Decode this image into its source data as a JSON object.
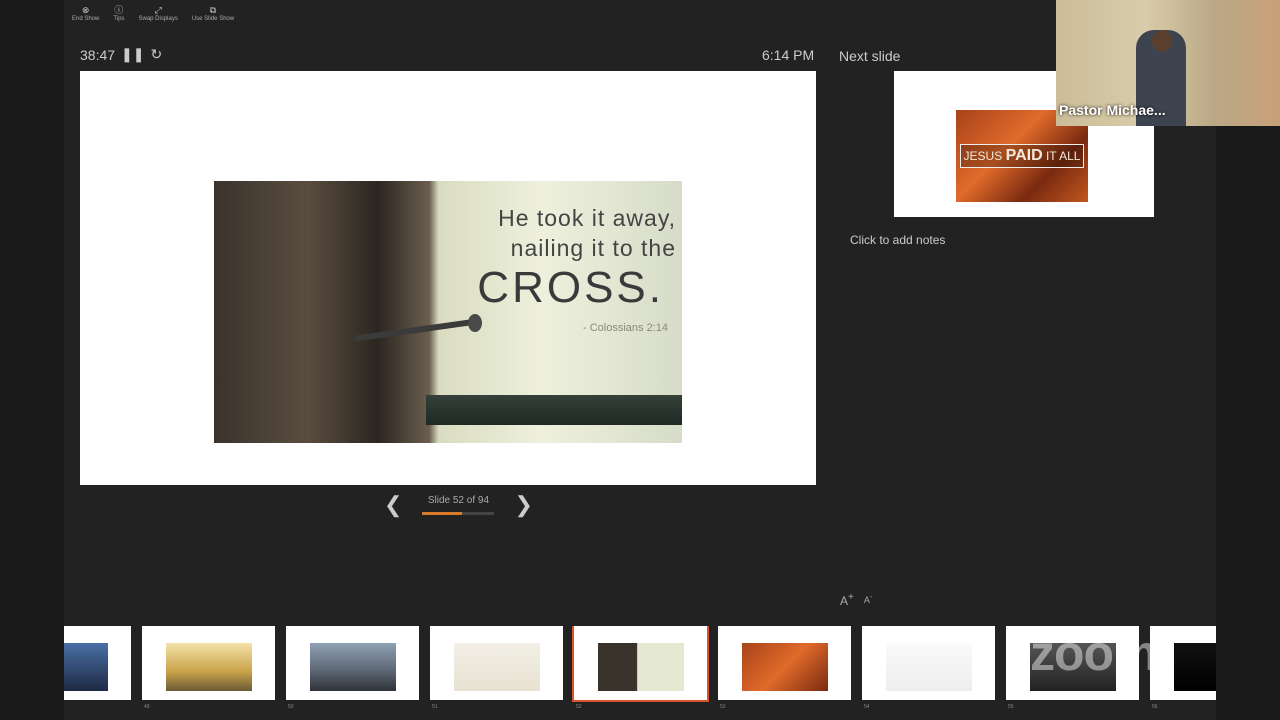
{
  "toolbar": {
    "items": [
      {
        "label": "End Show",
        "icon": "end-show-icon"
      },
      {
        "label": "Tips",
        "icon": "info-icon"
      },
      {
        "label": "Swap Displays",
        "icon": "swap-icon"
      },
      {
        "label": "Use Slide Show",
        "icon": "slideshow-icon"
      }
    ]
  },
  "presenter": {
    "timer": "38:47",
    "clock": "6:14 PM",
    "slide_counter": "Slide 52 of 94",
    "progress": 0.55,
    "next_label": "Next slide",
    "notes_placeholder": "Click to add notes",
    "font_up": "A",
    "font_down": "A"
  },
  "current_slide": {
    "line1": "He took it away,",
    "line2": "nailing it to the",
    "line3": "CROSS.",
    "reference": "- Colossians 2:14"
  },
  "next_slide": {
    "text_left": "JESUS",
    "text_main": "PAID",
    "text_right": "IT ALL"
  },
  "video": {
    "name": "Pastor Michae..."
  },
  "thumbnails": [
    {
      "num": "48",
      "art": "cross-silhouette",
      "selected": false
    },
    {
      "num": "49",
      "art": "sunset-figure",
      "selected": false
    },
    {
      "num": "50",
      "art": "three-crosses",
      "selected": false
    },
    {
      "num": "51",
      "art": "wooden-cross",
      "selected": false
    },
    {
      "num": "52",
      "art": "nail-cross",
      "selected": true
    },
    {
      "num": "53",
      "art": "jesus-paid",
      "selected": false
    },
    {
      "num": "54",
      "art": "sketch",
      "selected": false
    },
    {
      "num": "55",
      "art": "dark-scene",
      "selected": false
    },
    {
      "num": "56",
      "art": "black",
      "selected": false
    }
  ],
  "watermark": "zoom",
  "colors": {
    "accent": "#d9532b",
    "progress": "#d97a2b"
  }
}
